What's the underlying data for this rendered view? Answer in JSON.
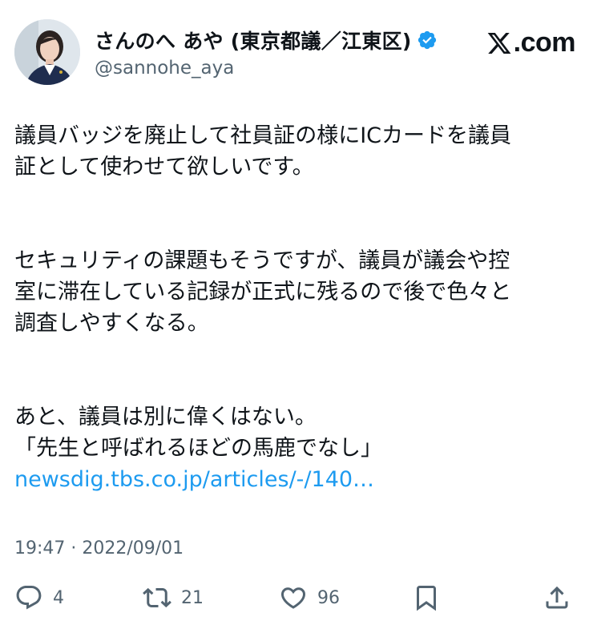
{
  "tweet": {
    "author": {
      "display_name": "さんのへ あや (東京都議／江東区)",
      "handle": "@sannohe_aya",
      "verified_icon": "verified-badge-icon",
      "avatar_icon": "avatar"
    },
    "brand": {
      "logo_icon": "x-logo-icon",
      "text": ".com"
    },
    "paragraphs": [
      [
        "議員バッジを廃止して社員証の様にICカードを議員",
        "証として使わせて欲しいです。"
      ],
      [
        "セキュリティの課題もそうですが、議員が議会や控",
        "室に滞在している記録が正式に残るので後で色々と",
        "調査しやすくなる。"
      ],
      [
        "あと、議員は別に偉くはない。",
        "「先生と呼ばれるほどの馬鹿でなし」"
      ]
    ],
    "link_text": "newsdig.tbs.co.jp/articles/-/140…",
    "timestamp": "19:47 · 2022/09/01",
    "actions": {
      "reply": {
        "icon": "reply-icon",
        "count": "4"
      },
      "retweet": {
        "icon": "retweet-icon",
        "count": "21"
      },
      "like": {
        "icon": "heart-icon",
        "count": "96"
      },
      "bookmark": {
        "icon": "bookmark-icon"
      },
      "share": {
        "icon": "share-icon"
      }
    },
    "colors": {
      "text": "#0f1419",
      "secondary": "#536471",
      "link": "#1d9bf0",
      "verified": "#1d9bf0"
    }
  }
}
